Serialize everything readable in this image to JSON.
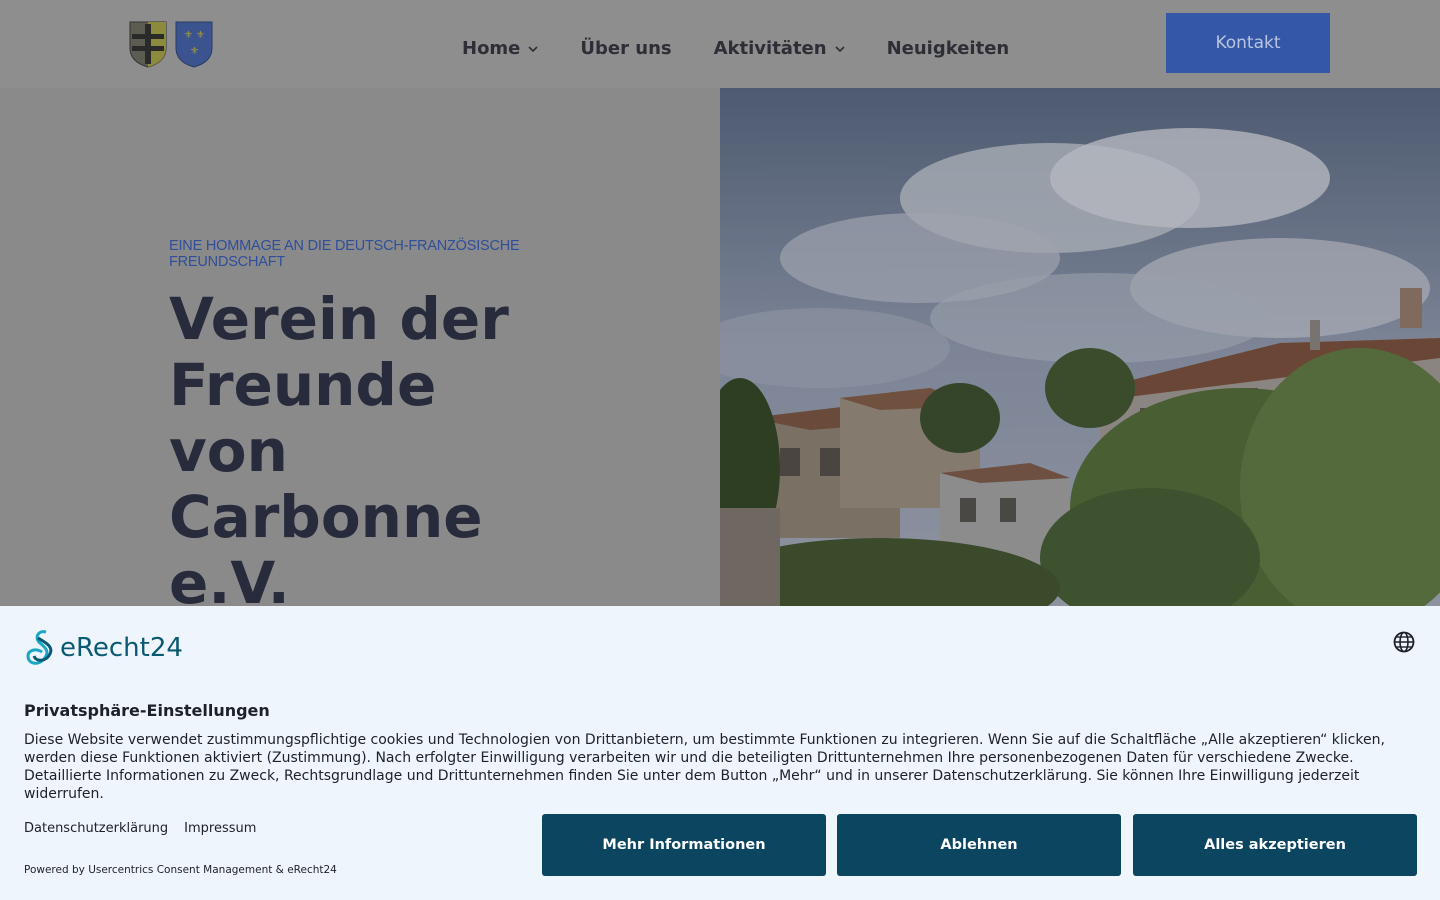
{
  "header": {
    "logo_alt": "Wappen",
    "nav": [
      {
        "label": "Home",
        "has_dropdown": true
      },
      {
        "label": "Über uns",
        "has_dropdown": false
      },
      {
        "label": "Aktivitäten",
        "has_dropdown": true
      },
      {
        "label": "Neuigkeiten",
        "has_dropdown": false
      }
    ],
    "cta_label": "Kontakt"
  },
  "hero": {
    "tagline": "EINE HOMMAGE AN DIE DEUTSCH-FRANZÖSISCHE FREUNDSCHAFT",
    "title": "Verein der Freunde von Carbonne e.V."
  },
  "consent": {
    "brand": "eRecht24",
    "title": "Privatsphäre-Einstellungen",
    "description": "Diese Website verwendet zustimmungspflichtige cookies und Technologien von Drittanbietern, um bestimmte Funktionen zu integrieren. Wenn Sie auf die Schaltfläche „Alle akzeptieren“ klicken, werden diese Funktionen aktiviert (Zustimmung). Nach erfolgter Einwilligung verarbeiten wir und die beteiligten Drittunternehmen Ihre personenbezogenen Daten für verschiedene Zwecke. Detaillierte Informationen zu Zweck, Rechtsgrundlage und Drittunternehmen finden Sie unter dem Button „Mehr“ und in unserer Datenschutzerklärung. Sie können Ihre Einwilligung jederzeit widerrufen.",
    "links": [
      "Datenschutzerklärung",
      "Impressum"
    ],
    "powered_by": "Powered by Usercentrics Consent Management & eRecht24",
    "buttons": {
      "more": "Mehr Informationen",
      "decline": "Ablehnen",
      "accept": "Alles akzeptieren"
    }
  },
  "colors": {
    "accent": "#3557a8",
    "consent_button": "#0b4560",
    "overlay_grey": "#8e8e8e"
  }
}
